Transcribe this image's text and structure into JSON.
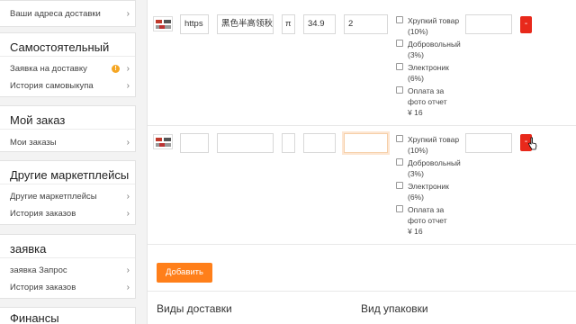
{
  "sidebar": {
    "top_item": "Ваши адреса доставки",
    "cards": [
      {
        "title": "Самостоятельный",
        "items": [
          "Заявка на доставку",
          "История самовыкупа"
        ]
      },
      {
        "title": "Мой заказ",
        "items": [
          "Мои заказы"
        ]
      },
      {
        "title": "Другие маркетплейсы",
        "items": [
          "Другие маркетплейсы",
          "История заказов"
        ]
      },
      {
        "title": "заявка",
        "items": [
          "заявка Запрос",
          "История заказов"
        ]
      },
      {
        "title": "Финансы",
        "items": []
      }
    ],
    "badge": "!",
    "chevron": "›"
  },
  "rows": [
    {
      "link": "https",
      "name": "黑色半高领秋",
      "spec": "π",
      "price": "34.9",
      "qty": "2",
      "note": "",
      "options": [
        {
          "label": "Хрупкий товар",
          "sub": "(10%)"
        },
        {
          "label": "Добровольный",
          "sub": "(3%)"
        },
        {
          "label": "Электроник",
          "sub": "(6%)"
        },
        {
          "label": "Оплата за",
          "sub": "фото отчет",
          "extra": "¥ 16"
        }
      ],
      "delete_label": "-"
    },
    {
      "link": "",
      "name": "",
      "spec": "",
      "price": "",
      "qty": "",
      "note": "",
      "options": [
        {
          "label": "Хрупкий товар",
          "sub": "(10%)"
        },
        {
          "label": "Добровольный",
          "sub": "(3%)"
        },
        {
          "label": "Электроник",
          "sub": "(6%)"
        },
        {
          "label": "Оплата за",
          "sub": "фото отчет",
          "extra": "¥ 16"
        }
      ],
      "delete_label": "-"
    }
  ],
  "add_button": "Добавить",
  "delivery_title": "Виды доставки",
  "packaging_title": "Вид упаковки",
  "colors": {
    "accent": "#ff7f1a",
    "delete": "#e8291b",
    "badge": "#f5a623"
  }
}
